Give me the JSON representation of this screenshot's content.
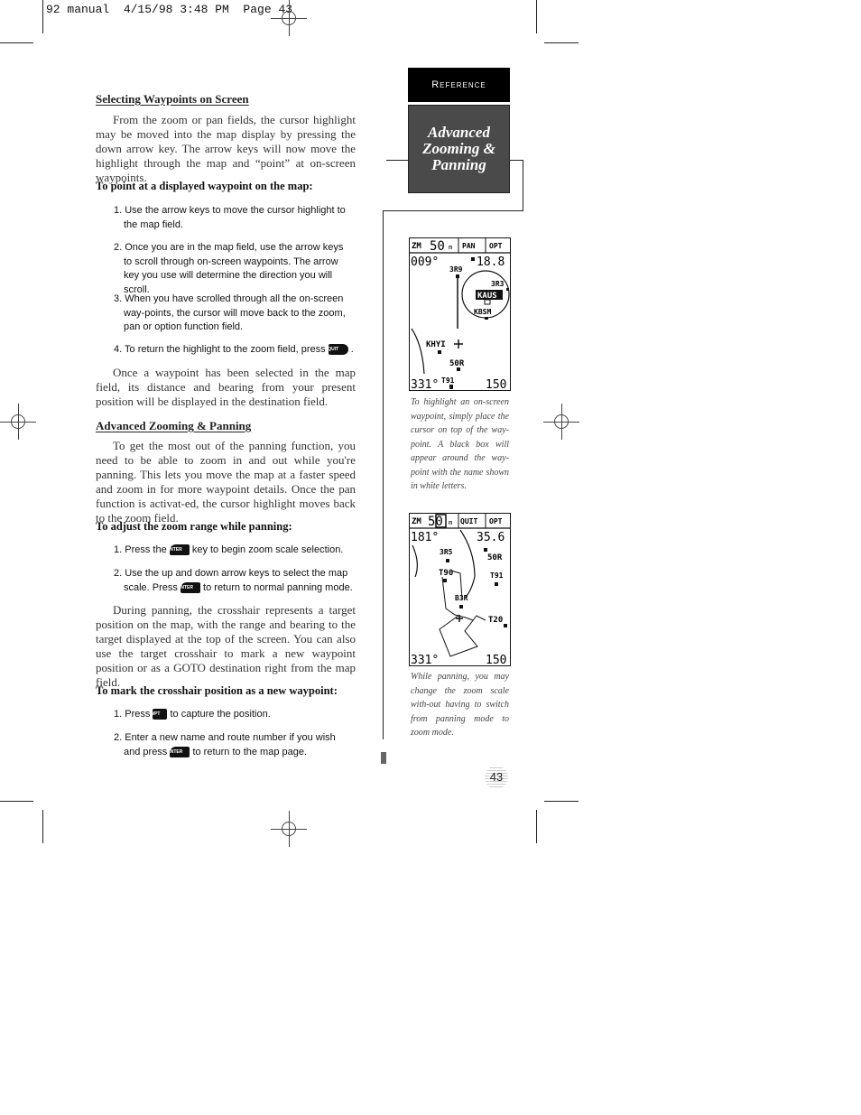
{
  "slug": "92 manual  4/15/98 3:48 PM  Page 43",
  "section_tab": "Reference",
  "section_title": [
    "Advanced",
    "Zooming &",
    "Panning"
  ],
  "page_number": "43",
  "sections": [
    {
      "heading": "Selecting Waypoints on Screen",
      "intro": "From the zoom or pan fields, the cursor highlight may be moved into the map display by pressing the down arrow key. The arrow keys will now move the highlight through the map and “point” at on-screen waypoints.",
      "subheading": "To point at a displayed waypoint on the map:",
      "steps": [
        "1. Use the arrow keys to move the cursor highlight to the map field.",
        "2. Once you are in the map field, use the arrow keys to scroll through on-screen waypoints. The arrow key you use will determine the direction you will scroll.",
        "3. When you have scrolled through all the on-screen way-points, the cursor will move back to the zoom, pan or option function field.",
        "4. To return the highlight to the zoom field, press"
      ],
      "outro": "Once a waypoint has been selected in the map field, its distance and bearing from your present position will be displayed in the destination field."
    },
    {
      "heading": "Advanced Zooming & Panning",
      "intro": "To get the most out of the panning function, you need to be able to zoom in and out while you're panning. This lets you move the map at a faster speed and zoom in for more waypoint details. Once the pan function is activat-ed, the cursor highlight moves back to the zoom field.",
      "subheading": "To adjust the zoom range while panning:",
      "steps": [
        [
          "1. Press the",
          "key to begin zoom scale selection."
        ],
        [
          "2. Use the up and down arrow keys to select the map scale. Press",
          "to return to normal panning mode."
        ]
      ],
      "outro": "During panning, the crosshair represents a target position on the map, with the range and bearing to the target displayed at the top of the screen. You can also use the target crosshair to mark a new waypoint position or as a GOTO destination right from the map field.",
      "subheading2": "To mark the crosshair position as a new waypoint:",
      "steps2": [
        [
          "1. Press",
          "to capture the position."
        ],
        [
          "2. Enter a new name and route number if you wish and press",
          "to return to the map page."
        ]
      ]
    }
  ],
  "keys": {
    "quit": "QUIT",
    "enter": "ENTER",
    "wpt": "WPT"
  },
  "screens": [
    {
      "zoom_label": "ZM",
      "zoom_value": "50",
      "zoom_unit": "m",
      "mid_button": "PAN",
      "opt_button": "OPT",
      "bearing": "009°",
      "distance": "18.8",
      "track": "331°",
      "speed": "150",
      "waypoints": [
        "3R9",
        "3R3",
        "KAUS",
        "KBSM",
        "KHYI",
        "50R",
        "T91"
      ],
      "highlighted": "KAUS",
      "caption": "To highlight an on-screen waypoint, simply place the cursor on top of the way-point. A black box will appear around the way-point with the name shown in white letters."
    },
    {
      "zoom_label": "ZM",
      "zoom_value": "50",
      "zoom_unit": "m",
      "mid_button": "QUIT",
      "opt_button": "OPT",
      "bearing": "181°",
      "distance": "35.6",
      "track": "331°",
      "speed": "150",
      "waypoints": [
        "3R5",
        "50R",
        "T90",
        "T91",
        "B3R",
        "T20"
      ],
      "caption": "While panning, you may change the zoom scale with-out having to switch from panning mode to zoom mode."
    }
  ]
}
